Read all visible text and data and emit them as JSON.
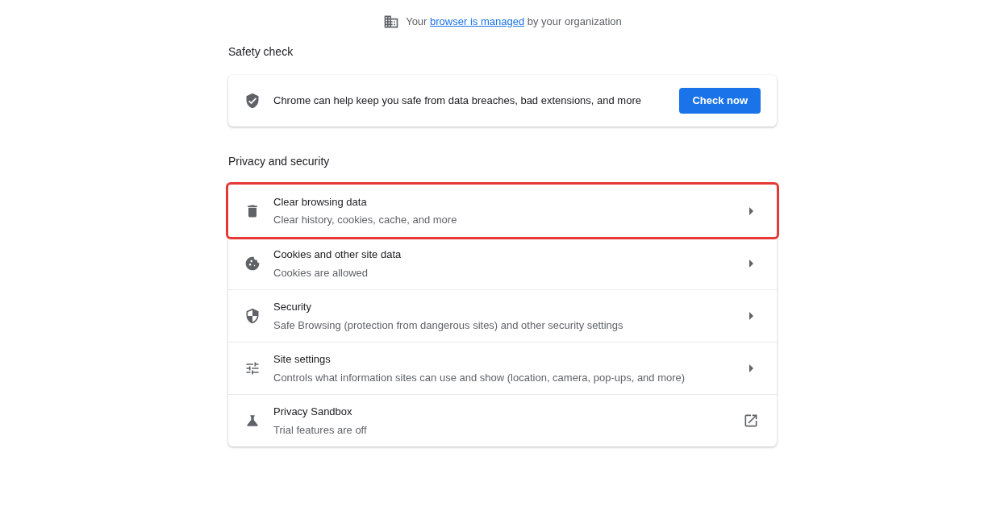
{
  "managed_notice": {
    "prefix": "Your",
    "link": "browser is managed",
    "suffix": "by your organization"
  },
  "safety_check": {
    "heading": "Safety check",
    "description": "Chrome can help keep you safe from data breaches, bad extensions, and more",
    "button": "Check now"
  },
  "privacy_and_security": {
    "heading": "Privacy and security",
    "items": [
      {
        "title": "Clear browsing data",
        "subtitle": "Clear history, cookies, cache, and more",
        "kind": "submenu",
        "highlighted": true
      },
      {
        "title": "Cookies and other site data",
        "subtitle": "Cookies are allowed",
        "kind": "submenu",
        "highlighted": false
      },
      {
        "title": "Security",
        "subtitle": "Safe Browsing (protection from dangerous sites) and other security settings",
        "kind": "submenu",
        "highlighted": false
      },
      {
        "title": "Site settings",
        "subtitle": "Controls what information sites can use and show (location, camera, pop-ups, and more)",
        "kind": "submenu",
        "highlighted": false
      },
      {
        "title": "Privacy Sandbox",
        "subtitle": "Trial features are off",
        "kind": "external",
        "highlighted": false
      }
    ]
  }
}
